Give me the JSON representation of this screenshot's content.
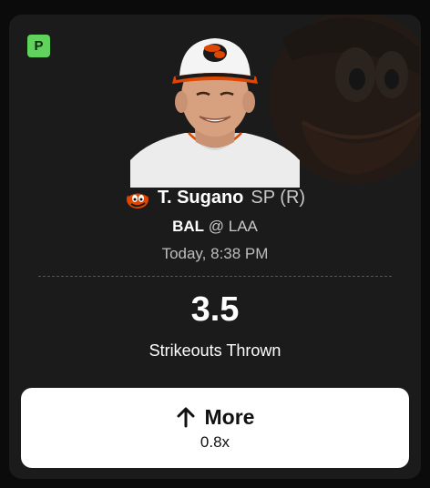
{
  "badge": {
    "letter": "P",
    "color": "#5fd35c"
  },
  "player": {
    "name": "T. Sugano",
    "position": "SP (R)",
    "team_icon": "orioles-bird-icon"
  },
  "matchup": {
    "team": "BAL",
    "separator": "@",
    "opponent": "LAA"
  },
  "game_time": "Today, 8:38 PM",
  "projection": {
    "value": "3.5",
    "stat": "Strikeouts Thrown"
  },
  "action": {
    "label": "More",
    "multiplier": "0.8x",
    "icon": "arrow-up-icon"
  },
  "colors": {
    "card_bg": "#1b1b1b",
    "accent_orange": "#df4601",
    "button_bg": "#ffffff"
  }
}
